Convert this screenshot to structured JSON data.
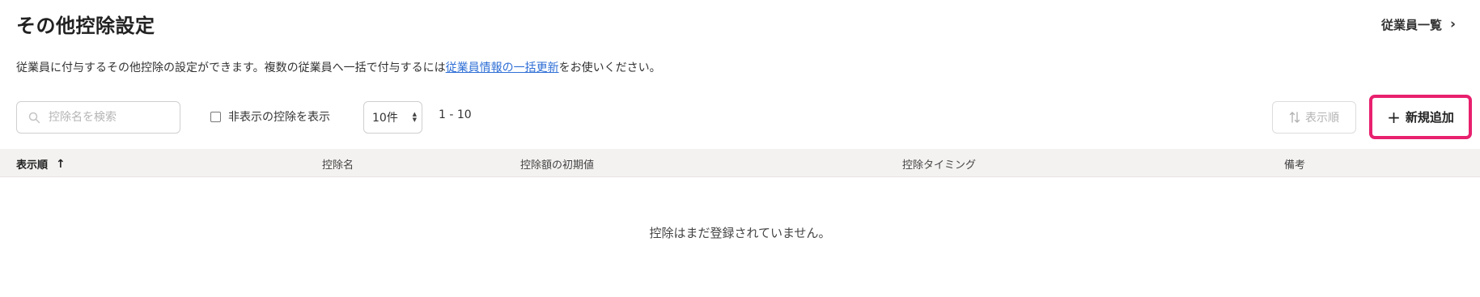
{
  "header": {
    "title": "その他控除設定",
    "employee_link": "従業員一覧"
  },
  "description": {
    "before": "従業員に付与するその他控除の設定ができます。複数の従業員へ一括で付与するには",
    "link": "従業員情報の一括更新",
    "after": "をお使いください。"
  },
  "toolbar": {
    "search_placeholder": "控除名を検索",
    "show_hidden_label": "非表示の控除を表示",
    "per_page": "10件",
    "range": "1 - 10",
    "sort_label": "表示順",
    "new_label": "新規追加"
  },
  "table": {
    "columns": [
      "表示順",
      "控除名",
      "控除額の初期値",
      "控除タイミング",
      "備考"
    ],
    "empty_message": "控除はまだ登録されていません。"
  },
  "colors": {
    "highlight": "#e8206e",
    "link": "#2f6fd6",
    "header_bg": "#f4f2f1"
  }
}
